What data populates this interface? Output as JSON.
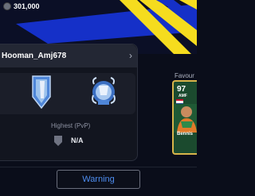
{
  "header": {
    "coins_value": "301,000",
    "coin_icon": "coin-icon"
  },
  "profile": {
    "username": "Hooman_Amj678",
    "badges": [
      "badge-shield-icon",
      "badge-trophy-icon"
    ],
    "highest_label": "Highest (PvP)",
    "highest_value": "N/A"
  },
  "favourite": {
    "label": "Favour",
    "rating": "97",
    "position": "AMF",
    "name": "Bennis"
  },
  "footer": {
    "warning_label": "Warning"
  },
  "colors": {
    "accent_blue": "#1530c8",
    "accent_yellow": "#f5dc1e",
    "link_blue": "#4d8df0"
  }
}
